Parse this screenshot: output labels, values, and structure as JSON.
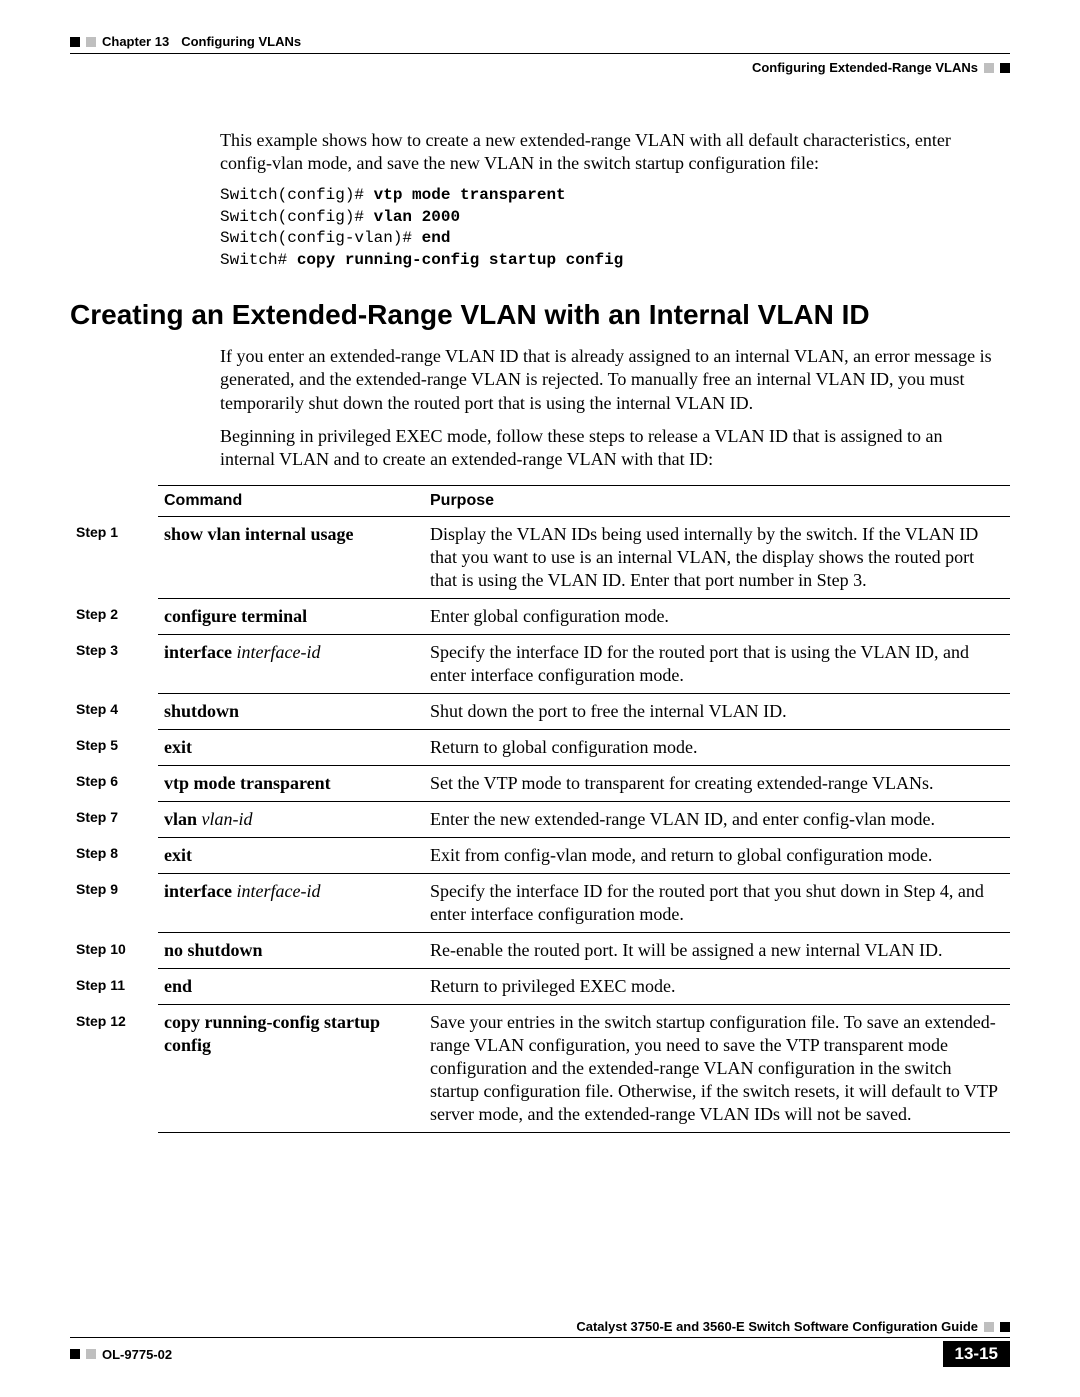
{
  "header": {
    "chapter": "Chapter 13",
    "chapter_title": "Configuring VLANs",
    "section_right": "Configuring Extended-Range VLANs"
  },
  "intro_paragraph": "This example shows how to create a new extended-range VLAN with all default characteristics, enter config-vlan mode, and save the new VLAN in the switch startup configuration file:",
  "cli": {
    "line1_prompt": "Switch(config)# ",
    "line1_cmd": "vtp mode transparent",
    "line2_prompt": "Switch(config)# ",
    "line2_cmd": "vlan 2000",
    "line3_prompt": "Switch(config-vlan)# ",
    "line3_cmd": "end",
    "line4_prompt": "Switch# ",
    "line4_cmd": "copy running-config startup config"
  },
  "section_heading": "Creating an Extended-Range VLAN with an Internal VLAN ID",
  "section_p1": "If you enter an extended-range VLAN ID that is already assigned to an internal VLAN, an error message is generated, and the extended-range VLAN is rejected. To manually free an internal VLAN ID, you must temporarily shut down the routed port that is using the internal VLAN ID.",
  "section_p2": "Beginning in privileged EXEC mode, follow these steps to release a VLAN ID that is assigned to an internal VLAN and to create an extended-range VLAN with that ID:",
  "table": {
    "headers": {
      "command": "Command",
      "purpose": "Purpose"
    },
    "rows": [
      {
        "step": "Step 1",
        "cmd_bold": "show vlan internal usage",
        "cmd_ital": "",
        "purpose": "Display the VLAN IDs being used internally by the switch. If the VLAN ID that you want to use is an internal VLAN, the display shows the routed port that is using the VLAN ID. Enter that port number in Step 3."
      },
      {
        "step": "Step 2",
        "cmd_bold": "configure terminal",
        "cmd_ital": "",
        "purpose": "Enter global configuration mode."
      },
      {
        "step": "Step 3",
        "cmd_bold": "interface",
        "cmd_ital": " interface-id",
        "purpose": "Specify the interface ID for the routed port that is using the VLAN ID, and enter interface configuration mode."
      },
      {
        "step": "Step 4",
        "cmd_bold": "shutdown",
        "cmd_ital": "",
        "purpose": "Shut down the port to free the internal VLAN ID."
      },
      {
        "step": "Step 5",
        "cmd_bold": "exit",
        "cmd_ital": "",
        "purpose": "Return to global configuration mode."
      },
      {
        "step": "Step 6",
        "cmd_bold": "vtp mode transparent",
        "cmd_ital": "",
        "purpose": "Set the VTP mode to transparent for creating extended-range VLANs."
      },
      {
        "step": "Step 7",
        "cmd_bold": "vlan",
        "cmd_ital": " vlan-id",
        "purpose": "Enter the new extended-range VLAN ID, and enter config-vlan mode."
      },
      {
        "step": "Step 8",
        "cmd_bold": "exit",
        "cmd_ital": "",
        "purpose": "Exit from config-vlan mode, and return to global configuration mode."
      },
      {
        "step": "Step 9",
        "cmd_bold": "interface",
        "cmd_ital": " interface-id",
        "purpose": "Specify the interface ID for the routed port that you shut down in Step 4, and enter interface configuration mode."
      },
      {
        "step": "Step 10",
        "cmd_bold": "no shutdown",
        "cmd_ital": "",
        "purpose": "Re-enable the routed port. It will be assigned a new internal VLAN ID."
      },
      {
        "step": "Step 11",
        "cmd_bold": "end",
        "cmd_ital": "",
        "purpose": "Return to privileged EXEC mode."
      },
      {
        "step": "Step 12",
        "cmd_bold": "copy running-config startup config",
        "cmd_ital": "",
        "purpose": "Save your entries in the switch startup configuration file. To save an extended-range VLAN configuration, you need to save the VTP transparent mode configuration and the extended-range VLAN configuration in the switch startup configuration file. Otherwise, if the switch resets, it will default to VTP server mode, and the extended-range VLAN IDs will not be saved."
      }
    ]
  },
  "footer": {
    "guide_title": "Catalyst 3750-E and 3560-E Switch Software Configuration Guide",
    "doc_id": "OL-9775-02",
    "page_number": "13-15"
  }
}
